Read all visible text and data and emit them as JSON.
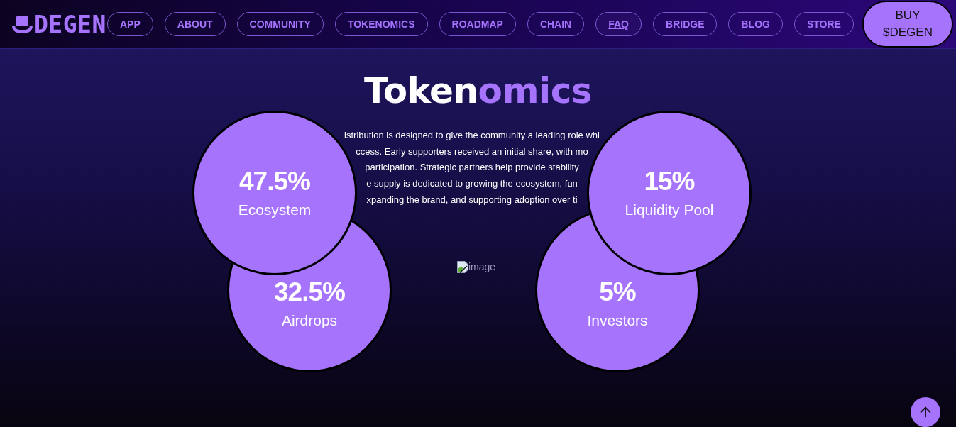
{
  "header": {
    "logo": {
      "text": "DEGEN"
    },
    "nav": [
      {
        "label": "APP",
        "hovered": false
      },
      {
        "label": "ABOUT",
        "hovered": false
      },
      {
        "label": "COMMUNITY",
        "hovered": false
      },
      {
        "label": "TOKENOMICS",
        "hovered": false
      },
      {
        "label": "ROADMAP",
        "hovered": false
      },
      {
        "label": "CHAIN",
        "hovered": false
      },
      {
        "label": "FAQ",
        "hovered": true
      },
      {
        "label": "BRIDGE",
        "hovered": false
      },
      {
        "label": "BLOG",
        "hovered": false
      },
      {
        "label": "STORE",
        "hovered": false
      }
    ],
    "cta": {
      "label": "BUY $DEGEN"
    }
  },
  "section": {
    "title": [
      {
        "text": "Token",
        "accent": false
      },
      {
        "text": "omics",
        "accent": true
      }
    ],
    "description_lines": [
      "istribution is designed to give the community a leading role whi",
      "ccess. Early supporters received an initial share, with mo",
      "participation. Strategic partners help provide stability",
      "e supply is dedicated to growing the ecosystem, fun",
      "xpanding the brand, and supporting adoption over ti"
    ],
    "allocations": [
      {
        "value": "47.5%",
        "label": "Ecosystem"
      },
      {
        "value": "15%",
        "label": "Liquidity Pool"
      },
      {
        "value": "32.5%",
        "label": "Airdrops"
      },
      {
        "value": "5%",
        "label": "Investors"
      }
    ],
    "image": {
      "alt": "image"
    }
  }
}
